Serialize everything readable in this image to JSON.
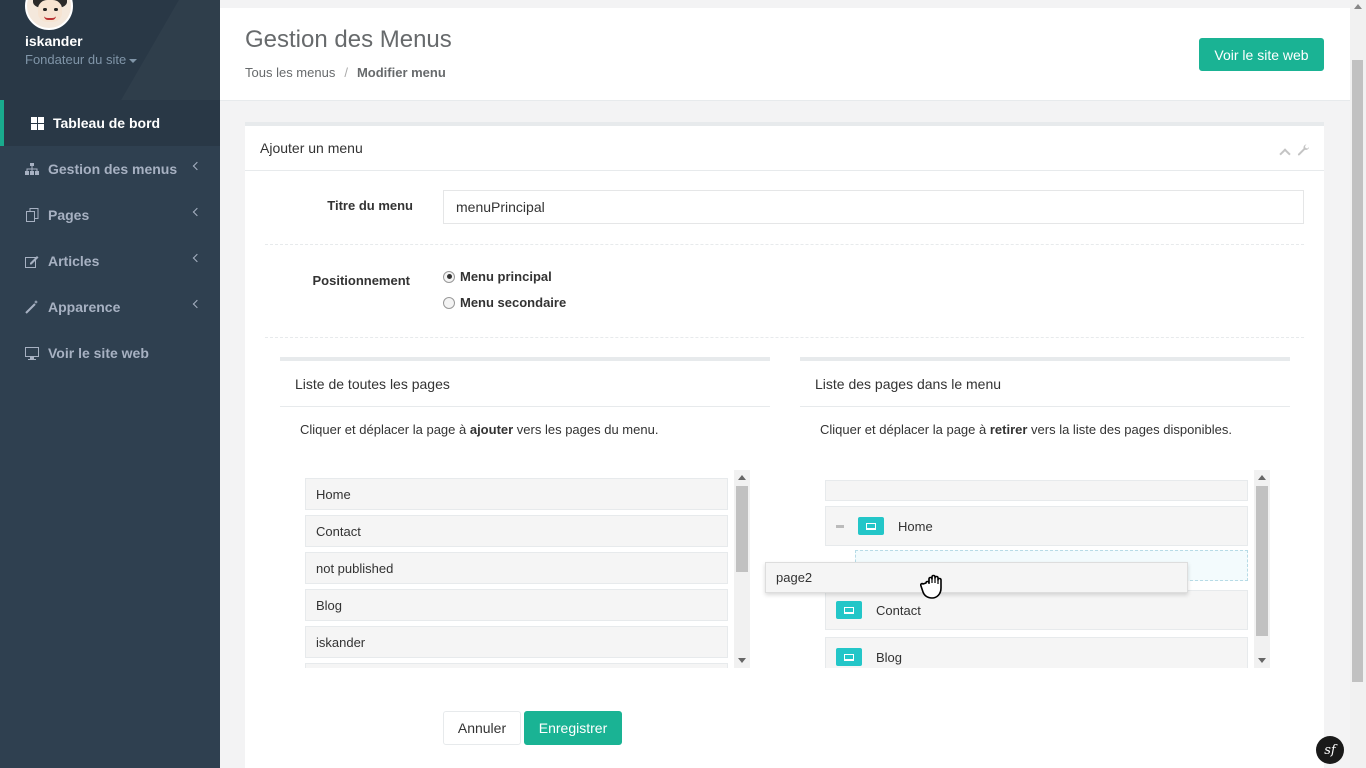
{
  "sidebar": {
    "user_name": "iskander",
    "user_role": "Fondateur du site",
    "nav": [
      {
        "label": "Tableau de bord",
        "icon": "th-large-icon"
      },
      {
        "label": "Gestion des menus",
        "icon": "sitemap-icon"
      },
      {
        "label": "Pages",
        "icon": "copy-icon"
      },
      {
        "label": "Articles",
        "icon": "edit-icon"
      },
      {
        "label": "Apparence",
        "icon": "magic-icon"
      },
      {
        "label": "Voir le site web",
        "icon": "desktop-icon"
      }
    ]
  },
  "header": {
    "title": "Gestion des Menus",
    "breadcrumb": [
      "Tous les menus",
      "Modifier menu"
    ],
    "site_button": "Voir le site web"
  },
  "form": {
    "box_title": "Ajouter un menu",
    "title_label": "Titre du menu",
    "title_value": "menuPrincipal",
    "position_label": "Positionnement",
    "positions": [
      {
        "label": "Menu principal",
        "checked": true
      },
      {
        "label": "Menu secondaire",
        "checked": false
      }
    ],
    "all_pages": {
      "title": "Liste de toutes les pages",
      "desc_before": "Cliquer et déplacer la page à ",
      "desc_bold": "ajouter",
      "desc_after": " vers les pages du menu.",
      "items": [
        "Home",
        "Contact",
        "not published",
        "Blog",
        "iskander"
      ]
    },
    "menu_pages": {
      "title": "Liste des pages dans le menu",
      "desc_before": "Cliquer et déplacer la page à ",
      "desc_bold": "retirer",
      "desc_after": " vers la liste des pages disponibles.",
      "items": [
        "Home",
        "Contact",
        "Blog"
      ]
    },
    "dragging_item": "page2",
    "cancel_label": "Annuler",
    "save_label": "Enregistrer"
  },
  "colors": {
    "sidebar": "#2f4050",
    "accent": "#1ab394",
    "page_icon": "#23c6c8"
  }
}
